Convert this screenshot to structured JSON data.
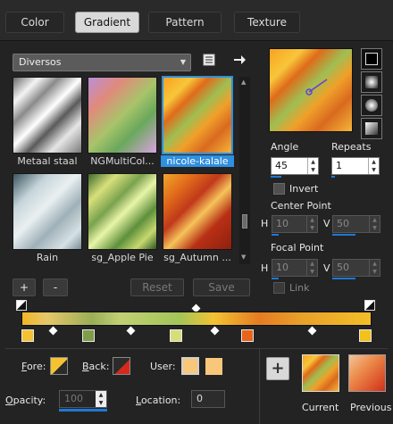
{
  "tabs": [
    {
      "label": "Color",
      "active": false
    },
    {
      "label": "Gradient",
      "active": true
    },
    {
      "label": "Pattern",
      "active": false
    },
    {
      "label": "Texture",
      "active": false
    }
  ],
  "gallery": {
    "category": "Diversos",
    "items": [
      {
        "label": "Metaal staal",
        "selected": false,
        "gradient": "linear-gradient(135deg,#6a6a6a 0%,#f4f4f4 18%,#8a8a8a 32%,#ffffff 48%,#5a5a5a 62%,#e6e6e6 78%,#7a7a7a 100%)"
      },
      {
        "label": "NGMultiCol...",
        "selected": false,
        "gradient": "linear-gradient(135deg,#b98fd8 0%,#e18a7c 25%,#a8c46a 50%,#6aa85c 70%,#d9a3e0 100%)"
      },
      {
        "label": "nicole-kalale",
        "selected": true,
        "gradient": "linear-gradient(135deg,#f9a21f 0%,#f7c63a 20%,#e06b1a 32%,#9fbe52 48%,#f0a02a 62%,#d96a1f 78%,#f4b53a 100%)"
      },
      {
        "label": "Rain",
        "selected": false,
        "gradient": "linear-gradient(135deg,#3b5560 0%,#c7d5da 25%,#e9f0f2 45%,#9fb1b8 65%,#d6e1e4 85%,#7a8e95 100%)"
      },
      {
        "label": "sg_Apple Pie",
        "selected": false,
        "gradient": "linear-gradient(135deg,#3f6a2c 0%,#d7e07a 20%,#7aa24e 38%,#e9f5a8 52%,#5e8f3b 70%,#c6d86f 85%,#2f5524 100%)"
      },
      {
        "label": "sg_Autumn ...",
        "selected": false,
        "gradient": "linear-gradient(135deg,#f2a72a 0%,#e06a1a 22%,#c0391a 40%,#f6c35a 55%,#b83015 72%,#8f1f0f 100%)"
      }
    ],
    "buttons": {
      "add": "+",
      "remove": "-",
      "reset": "Reset",
      "save": "Save"
    }
  },
  "icons": {
    "library": "library-icon",
    "apply": "arrow-right-icon"
  },
  "settings": {
    "angle_label": "Angle",
    "angle_value": "45",
    "repeats_label": "Repeats",
    "repeats_value": "1",
    "invert_label": "Invert",
    "center_point_label": "Center Point",
    "center_h_label": "H",
    "center_h_value": "10",
    "center_v_label": "V",
    "center_v_value": "50",
    "focal_point_label": "Focal Point",
    "focal_h_label": "H",
    "focal_h_value": "10",
    "focal_v_label": "V",
    "focal_v_value": "50",
    "link_label": "Link"
  },
  "gradient_editor": {
    "bar_gradient": "linear-gradient(90deg,#f0b526 0%,#e7c76a 7%,#9aae56 20%,#c2d074 28%,#a3c558 45%,#f3c233 55%,#e57c22 68%,#e8a029 80%,#f3be28 100%)",
    "stops": [
      {
        "color": "#f5c232",
        "position": 0
      },
      {
        "color": "#7f9c4a",
        "position": 18
      },
      {
        "color": "#d6de7a",
        "position": 44
      },
      {
        "color": "#e8641a",
        "position": 65
      },
      {
        "color": "#f4c11a",
        "position": 100
      }
    ],
    "midpoints": [
      9,
      31,
      55,
      83
    ]
  },
  "bottom": {
    "fore_label": "Fore:",
    "back_label": "Back:",
    "user_label": "User:",
    "opacity_label": "Opacity:",
    "opacity_value": "100",
    "location_label": "Location:",
    "location_value": "0",
    "current_label": "Current",
    "previous_label": "Previous",
    "add_label": "+"
  }
}
